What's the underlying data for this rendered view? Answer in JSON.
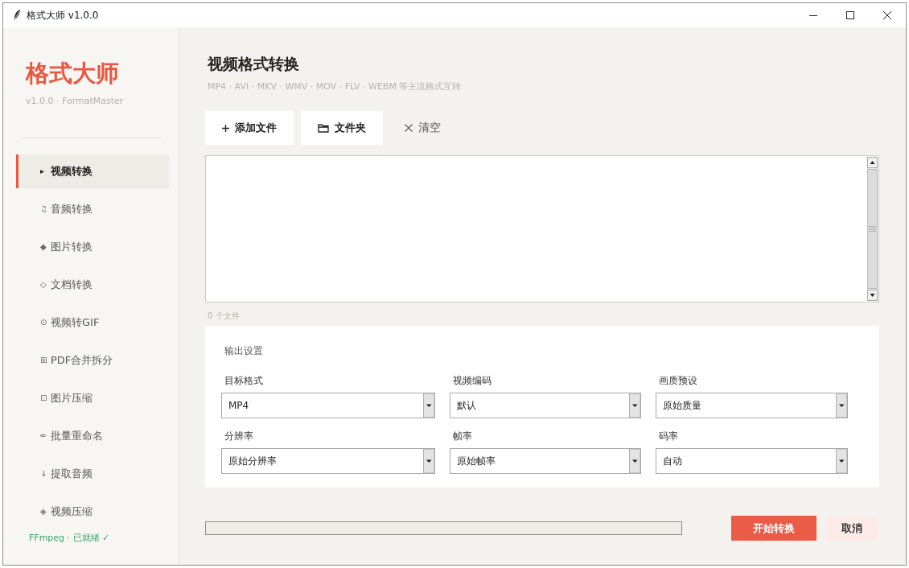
{
  "window": {
    "title": "格式大师 v1.0.0"
  },
  "sidebar": {
    "logo": "格式大师",
    "subtitle": "v1.0.0 · FormatMaster",
    "items": [
      {
        "icon": "▸",
        "label": "视频转换",
        "selected": true
      },
      {
        "icon": "♫",
        "label": "音频转换",
        "selected": false
      },
      {
        "icon": "◆",
        "label": "图片转换",
        "selected": false
      },
      {
        "icon": "◇",
        "label": "文档转换",
        "selected": false
      },
      {
        "icon": "⊙",
        "label": "视频转GIF",
        "selected": false
      },
      {
        "icon": "⊞",
        "label": "PDF合并拆分",
        "selected": false
      },
      {
        "icon": "⊡",
        "label": "图片压缩",
        "selected": false
      },
      {
        "icon": "✏",
        "label": "批量重命名",
        "selected": false
      },
      {
        "icon": "↓",
        "label": "提取音频",
        "selected": false
      },
      {
        "icon": "◈",
        "label": "视频压缩",
        "selected": false
      }
    ],
    "status": "FFmpeg · 已就绪 ✓"
  },
  "page": {
    "title": "视频格式转换",
    "subtitle": "MP4 · AVI · MKV · WMV · MOV · FLV · WEBM 等主流格式互转"
  },
  "toolbar": [
    {
      "label": "添加文件",
      "kind": "filled"
    },
    {
      "label": "文件夹",
      "kind": "filled"
    },
    {
      "label": "清空",
      "kind": "plain"
    }
  ],
  "file_list": {
    "count": "0 个文件"
  },
  "output_settings": {
    "title": "输出设置",
    "fields": [
      {
        "label": "目标格式",
        "value": "MP4"
      },
      {
        "label": "视频编码",
        "value": "默认"
      },
      {
        "label": "画质预设",
        "value": "原始质量"
      },
      {
        "label": "分辨率",
        "value": "原始分辨率"
      },
      {
        "label": "帧率",
        "value": "原始帧率"
      },
      {
        "label": "码率",
        "value": "自动"
      }
    ]
  },
  "progress": {
    "level": 0
  },
  "actions": [
    {
      "label": "开始转换",
      "kind": "primary"
    },
    {
      "label": "取消",
      "kind": "secondary"
    }
  ]
}
